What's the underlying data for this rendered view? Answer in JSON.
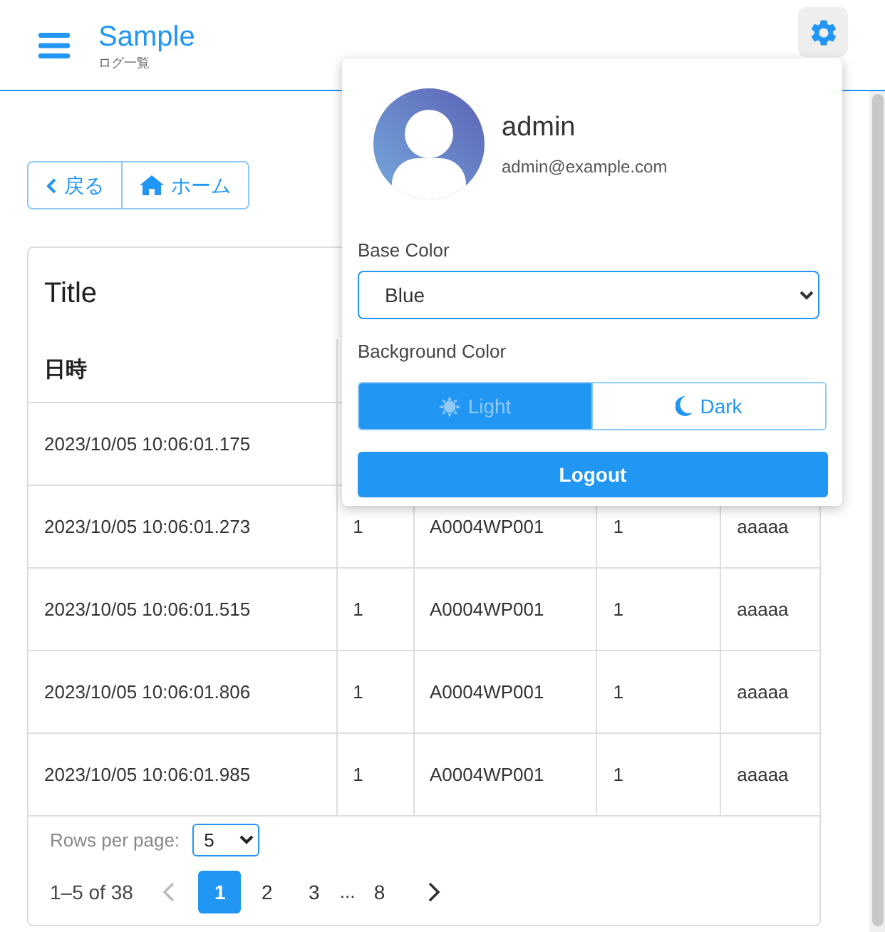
{
  "app_bar": {
    "title": "Sample",
    "subtitle": "ログ一覧"
  },
  "nav_buttons": [
    {
      "kind": "back",
      "label": "戻る"
    },
    {
      "kind": "home",
      "label": "ホーム"
    }
  ],
  "table": {
    "title": "Title",
    "columns": [
      "日時"
    ],
    "rows": [
      [
        "2023/10/05 10:06:01.175"
      ],
      [
        "2023/10/05 10:06:01.273",
        "1",
        "A0004WP001",
        "1",
        "aaaaa"
      ],
      [
        "2023/10/05 10:06:01.515",
        "1",
        "A0004WP001",
        "1",
        "aaaaa"
      ],
      [
        "2023/10/05 10:06:01.806",
        "1",
        "A0004WP001",
        "1",
        "aaaaa"
      ],
      [
        "2023/10/05 10:06:01.985",
        "1",
        "A0004WP001",
        "1",
        "aaaaa"
      ]
    ],
    "rows_per_page_label": "Rows per page:",
    "rows_per_page": "5",
    "range": "1–5 of 38",
    "prev_disabled": true,
    "next_disabled": false,
    "pages": [
      {
        "kind": "page",
        "label": "1",
        "selected": true
      },
      {
        "kind": "page",
        "label": "2",
        "selected": false
      },
      {
        "kind": "page",
        "label": "3",
        "selected": false
      },
      {
        "kind": "ellipsis",
        "label": "..."
      },
      {
        "kind": "page",
        "label": "8",
        "selected": false
      }
    ]
  },
  "user_menu": {
    "name": "admin",
    "email": "admin@example.com",
    "base_color_label": "Base Color",
    "base_color": "Blue",
    "background_label": "Background Color",
    "background_options": [
      {
        "kind": "light",
        "label": "Light",
        "selected": true
      },
      {
        "kind": "dark",
        "label": "Dark",
        "selected": false
      }
    ],
    "logout": "Logout"
  }
}
